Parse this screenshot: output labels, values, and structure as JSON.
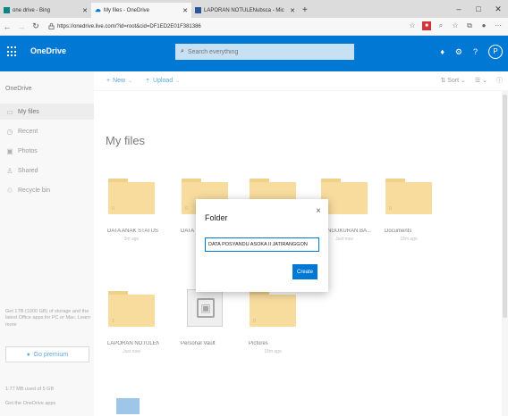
{
  "browser": {
    "tabs": [
      {
        "label": "one drive - Bing",
        "active": false
      },
      {
        "label": "My files - OneDrive",
        "active": true
      },
      {
        "label": "LAPORAN NOTULENubsca - Mic",
        "active": false
      }
    ],
    "new_tab_label": "+",
    "url": "https://onedrive.live.com/?id=root&cid=DF1ED2E01F381386",
    "window_controls": [
      "–",
      "□",
      "✕"
    ]
  },
  "header": {
    "app_name": "OneDrive",
    "search_placeholder": "Search everything",
    "avatar_label": "P"
  },
  "sidebar": {
    "title": "OneDrive",
    "items": [
      {
        "label": "My files",
        "icon": "folder-icon",
        "selected": true
      },
      {
        "label": "Recent",
        "icon": "clock-icon",
        "selected": false
      },
      {
        "label": "Photos",
        "icon": "photo-icon",
        "selected": false
      },
      {
        "label": "Shared",
        "icon": "people-icon",
        "selected": false
      },
      {
        "label": "Recycle bin",
        "icon": "recycle-bin-icon",
        "selected": false
      }
    ],
    "promo": "Get 1TB (1000 GB) of storage and the latest Office apps for PC or Mac. Learn more",
    "premium_button": "Go premium",
    "usage": "1.77 MB used of 5 GB",
    "get_apps": "Get the OneDrive apps"
  },
  "commandbar": {
    "new_label": "New",
    "upload_label": "Upload",
    "sort_label": "Sort"
  },
  "main": {
    "title": "My files",
    "tiles": [
      {
        "name": "DATA ANAK STATUS GIZI",
        "sub": "3m ago",
        "count": "0"
      },
      {
        "name": "DATA",
        "sub": "",
        "count": "0"
      },
      {
        "name": "",
        "sub": "",
        "count": "0"
      },
      {
        "name": "PENGUKURAN BA...",
        "sub": "Just now",
        "count": "0"
      },
      {
        "name": "Documents",
        "sub": "18m ago",
        "count": "0"
      },
      {
        "name": "LAPORAN NOTULEN P...",
        "sub": "Just now",
        "count": "1"
      },
      {
        "name": "Personal Vault",
        "sub": "",
        "count": ""
      },
      {
        "name": "Pictures",
        "sub": "18m ago",
        "count": "0"
      }
    ]
  },
  "dialog": {
    "title": "Folder",
    "input_value": "DATA POSYANDU ASOKA II JATIRANGGON",
    "create_label": "Create",
    "close_glyph": "×"
  },
  "colors": {
    "brand": "#0078d4",
    "folder": "#f5c96a"
  }
}
